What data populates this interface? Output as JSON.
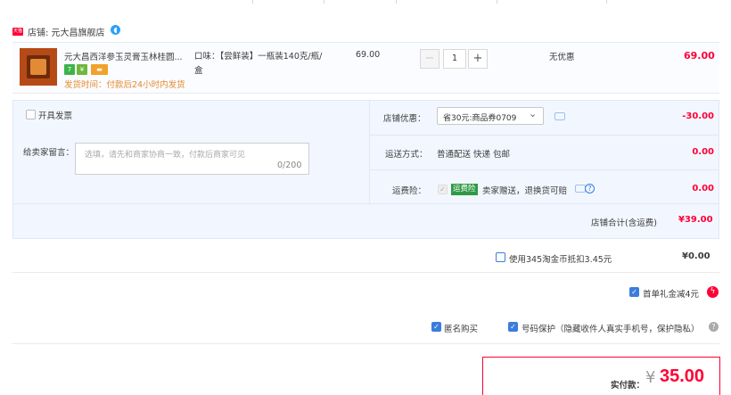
{
  "shop": {
    "badge": "天猫",
    "name": "店铺: 元大昌旗舰店",
    "chat_icon": "chat-bubble-icon"
  },
  "item": {
    "title": "元大昌西洋参玉灵膏玉林桂圆...",
    "tags": [
      "7",
      "¥",
      "▬"
    ],
    "ship_time": "发货时间：付款后24小时内发货",
    "spec": "口味：【尝鲜装】一瓶装140克/瓶/盒",
    "unit_price": "69.00",
    "qty_minus": "−",
    "qty_value": "1",
    "qty_plus": "+",
    "promo": "无优惠",
    "line_total": "69.00"
  },
  "options": {
    "invoice_label": "开具发票",
    "note_label": "给卖家留言：",
    "note_placeholder": "选填，请先和商家协商一致，付款后商家可见",
    "note_count": "0/200",
    "shop_discount_label": "店铺优惠：",
    "shop_discount_select": "省30元:商品券0709",
    "shop_discount_amount": "-30.00",
    "shipping_label": "运送方式：",
    "shipping_value": "普通配送 快递 包邮",
    "shipping_amount": "0.00",
    "insurance_label": "运费险：",
    "insurance_tag": "运费险",
    "insurance_value": "卖家赠送，退换货可赔",
    "insurance_amount": "0.00",
    "subtotal_label": "店铺合计(含运费)",
    "subtotal_value": "¥39.00"
  },
  "extras": {
    "coin_label": "使用345淘金币抵扣3.45元",
    "coin_amount": "¥0.00",
    "first_order_label": "首单礼金减4元",
    "anonymous_label": "匿名购买",
    "privacy_label": "号码保护（隐藏收件人真实手机号，保护隐私）"
  },
  "payment": {
    "label": "实付款：",
    "currency": "¥",
    "value": "35.00"
  },
  "colors": {
    "accent_red": "#ff0036",
    "option_bg": "#f2f7ff",
    "checkbox_blue": "#3b7ddd",
    "ship_orange": "#e68a2e"
  }
}
